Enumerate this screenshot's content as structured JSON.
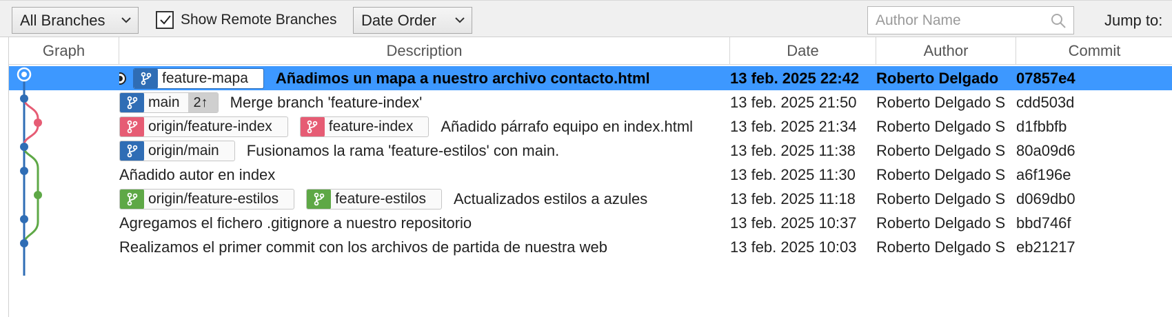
{
  "toolbar": {
    "branches_dropdown": "All Branches",
    "show_remote_label": "Show Remote Branches",
    "show_remote_checked": true,
    "order_dropdown": "Date Order",
    "author_placeholder": "Author Name",
    "jump_label": "Jump to:"
  },
  "columns": {
    "graph": "Graph",
    "description": "Description",
    "date": "Date",
    "author": "Author",
    "commit": "Commit"
  },
  "colors": {
    "selection": "#3d98ff",
    "branch_blue": "#2f6db5",
    "branch_red": "#e65c74",
    "branch_green": "#5ea846"
  },
  "commits": [
    {
      "head": true,
      "tags": [
        {
          "label": "feature-mapa",
          "color": "blue"
        }
      ],
      "message": "Añadimos un mapa a nuestro archivo contacto.html",
      "date": "13 feb. 2025 22:42",
      "author": "Roberto Delgado",
      "hash": "07857e4"
    },
    {
      "tags": [
        {
          "label": "main",
          "color": "blue",
          "count": "2↑"
        }
      ],
      "message": "Merge branch 'feature-index'",
      "date": "13 feb. 2025 21:50",
      "author": "Roberto Delgado S",
      "hash": "cdd503d"
    },
    {
      "tags": [
        {
          "label": "origin/feature-index",
          "color": "red"
        },
        {
          "label": "feature-index",
          "color": "red"
        }
      ],
      "message": "Añadido párrafo equipo en index.html",
      "date": "13 feb. 2025 21:34",
      "author": "Roberto Delgado S",
      "hash": "d1fbbfb"
    },
    {
      "tags": [
        {
          "label": "origin/main",
          "color": "blue"
        }
      ],
      "message": "Fusionamos la rama 'feature-estilos' con main.",
      "date": "13 feb. 2025 11:38",
      "author": "Roberto Delgado S",
      "hash": "80a09d6"
    },
    {
      "tags": [],
      "message": "Añadido autor en index",
      "date": "13 feb. 2025 11:30",
      "author": "Roberto Delgado S",
      "hash": "a6f196e"
    },
    {
      "tags": [
        {
          "label": "origin/feature-estilos",
          "color": "green"
        },
        {
          "label": "feature-estilos",
          "color": "green"
        }
      ],
      "message": "Actualizados estilos a azules",
      "date": "13 feb. 2025 11:18",
      "author": "Roberto Delgado S",
      "hash": "d069db0"
    },
    {
      "tags": [],
      "message": "Agregamos el fichero .gitignore a nuestro repositorio",
      "date": "13 feb. 2025 10:37",
      "author": "Roberto Delgado S",
      "hash": "bbd746f"
    },
    {
      "tags": [],
      "message": "Realizamos el primer commit con los archivos de partida de nuestra web",
      "date": "13 feb. 2025 10:03",
      "author": "Roberto Delgado S",
      "hash": "eb21217"
    }
  ],
  "graph": {
    "lanes_per_commit": [
      0,
      0,
      1,
      0,
      0,
      1,
      0,
      0
    ]
  }
}
